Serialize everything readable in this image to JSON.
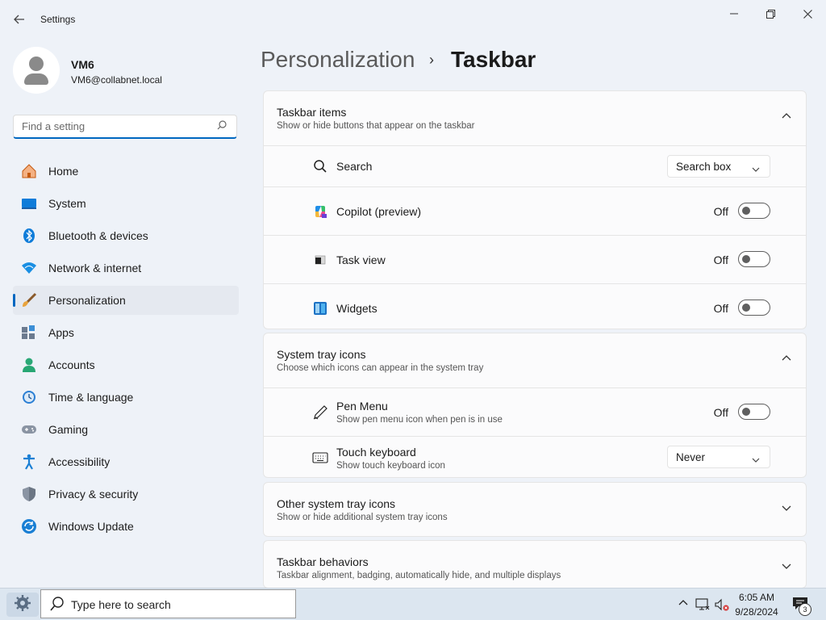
{
  "window": {
    "title": "Settings",
    "minimize": "—",
    "maximize": "❐",
    "close": "✕"
  },
  "profile": {
    "name": "VM6",
    "email": "VM6@collabnet.local"
  },
  "search": {
    "placeholder": "Find a setting"
  },
  "nav": [
    {
      "label": "Home",
      "icon": "home-icon"
    },
    {
      "label": "System",
      "icon": "system-icon"
    },
    {
      "label": "Bluetooth & devices",
      "icon": "bluetooth-icon"
    },
    {
      "label": "Network & internet",
      "icon": "network-icon"
    },
    {
      "label": "Personalization",
      "icon": "brush-icon",
      "active": true
    },
    {
      "label": "Apps",
      "icon": "apps-icon"
    },
    {
      "label": "Accounts",
      "icon": "accounts-icon"
    },
    {
      "label": "Time & language",
      "icon": "clock-icon"
    },
    {
      "label": "Gaming",
      "icon": "gamepad-icon"
    },
    {
      "label": "Accessibility",
      "icon": "accessibility-icon"
    },
    {
      "label": "Privacy & security",
      "icon": "shield-icon"
    },
    {
      "label": "Windows Update",
      "icon": "update-icon"
    }
  ],
  "breadcrumb": {
    "parent": "Personalization",
    "separator": "›",
    "current": "Taskbar"
  },
  "taskbar_items": {
    "title": "Taskbar items",
    "subtitle": "Show or hide buttons that appear on the taskbar",
    "search": {
      "label": "Search",
      "value": "Search box"
    },
    "copilot": {
      "label": "Copilot (preview)",
      "state": "Off"
    },
    "taskview": {
      "label": "Task view",
      "state": "Off"
    },
    "widgets": {
      "label": "Widgets",
      "state": "Off"
    }
  },
  "system_tray": {
    "title": "System tray icons",
    "subtitle": "Choose which icons can appear in the system tray",
    "pen": {
      "label": "Pen Menu",
      "sub": "Show pen menu icon when pen is in use",
      "state": "Off"
    },
    "touch": {
      "label": "Touch keyboard",
      "sub": "Show touch keyboard icon",
      "value": "Never"
    }
  },
  "other_tray": {
    "title": "Other system tray icons",
    "subtitle": "Show or hide additional system tray icons"
  },
  "behaviors": {
    "title": "Taskbar behaviors",
    "subtitle": "Taskbar alignment, badging, automatically hide, and multiple displays"
  },
  "os_taskbar": {
    "search_text": "Type here to search",
    "time": "6:05 AM",
    "date": "9/28/2024",
    "notifications": "3"
  },
  "colors": {
    "accent": "#0067c0",
    "background": "#eef2f8",
    "card": "#fbfbfc"
  }
}
